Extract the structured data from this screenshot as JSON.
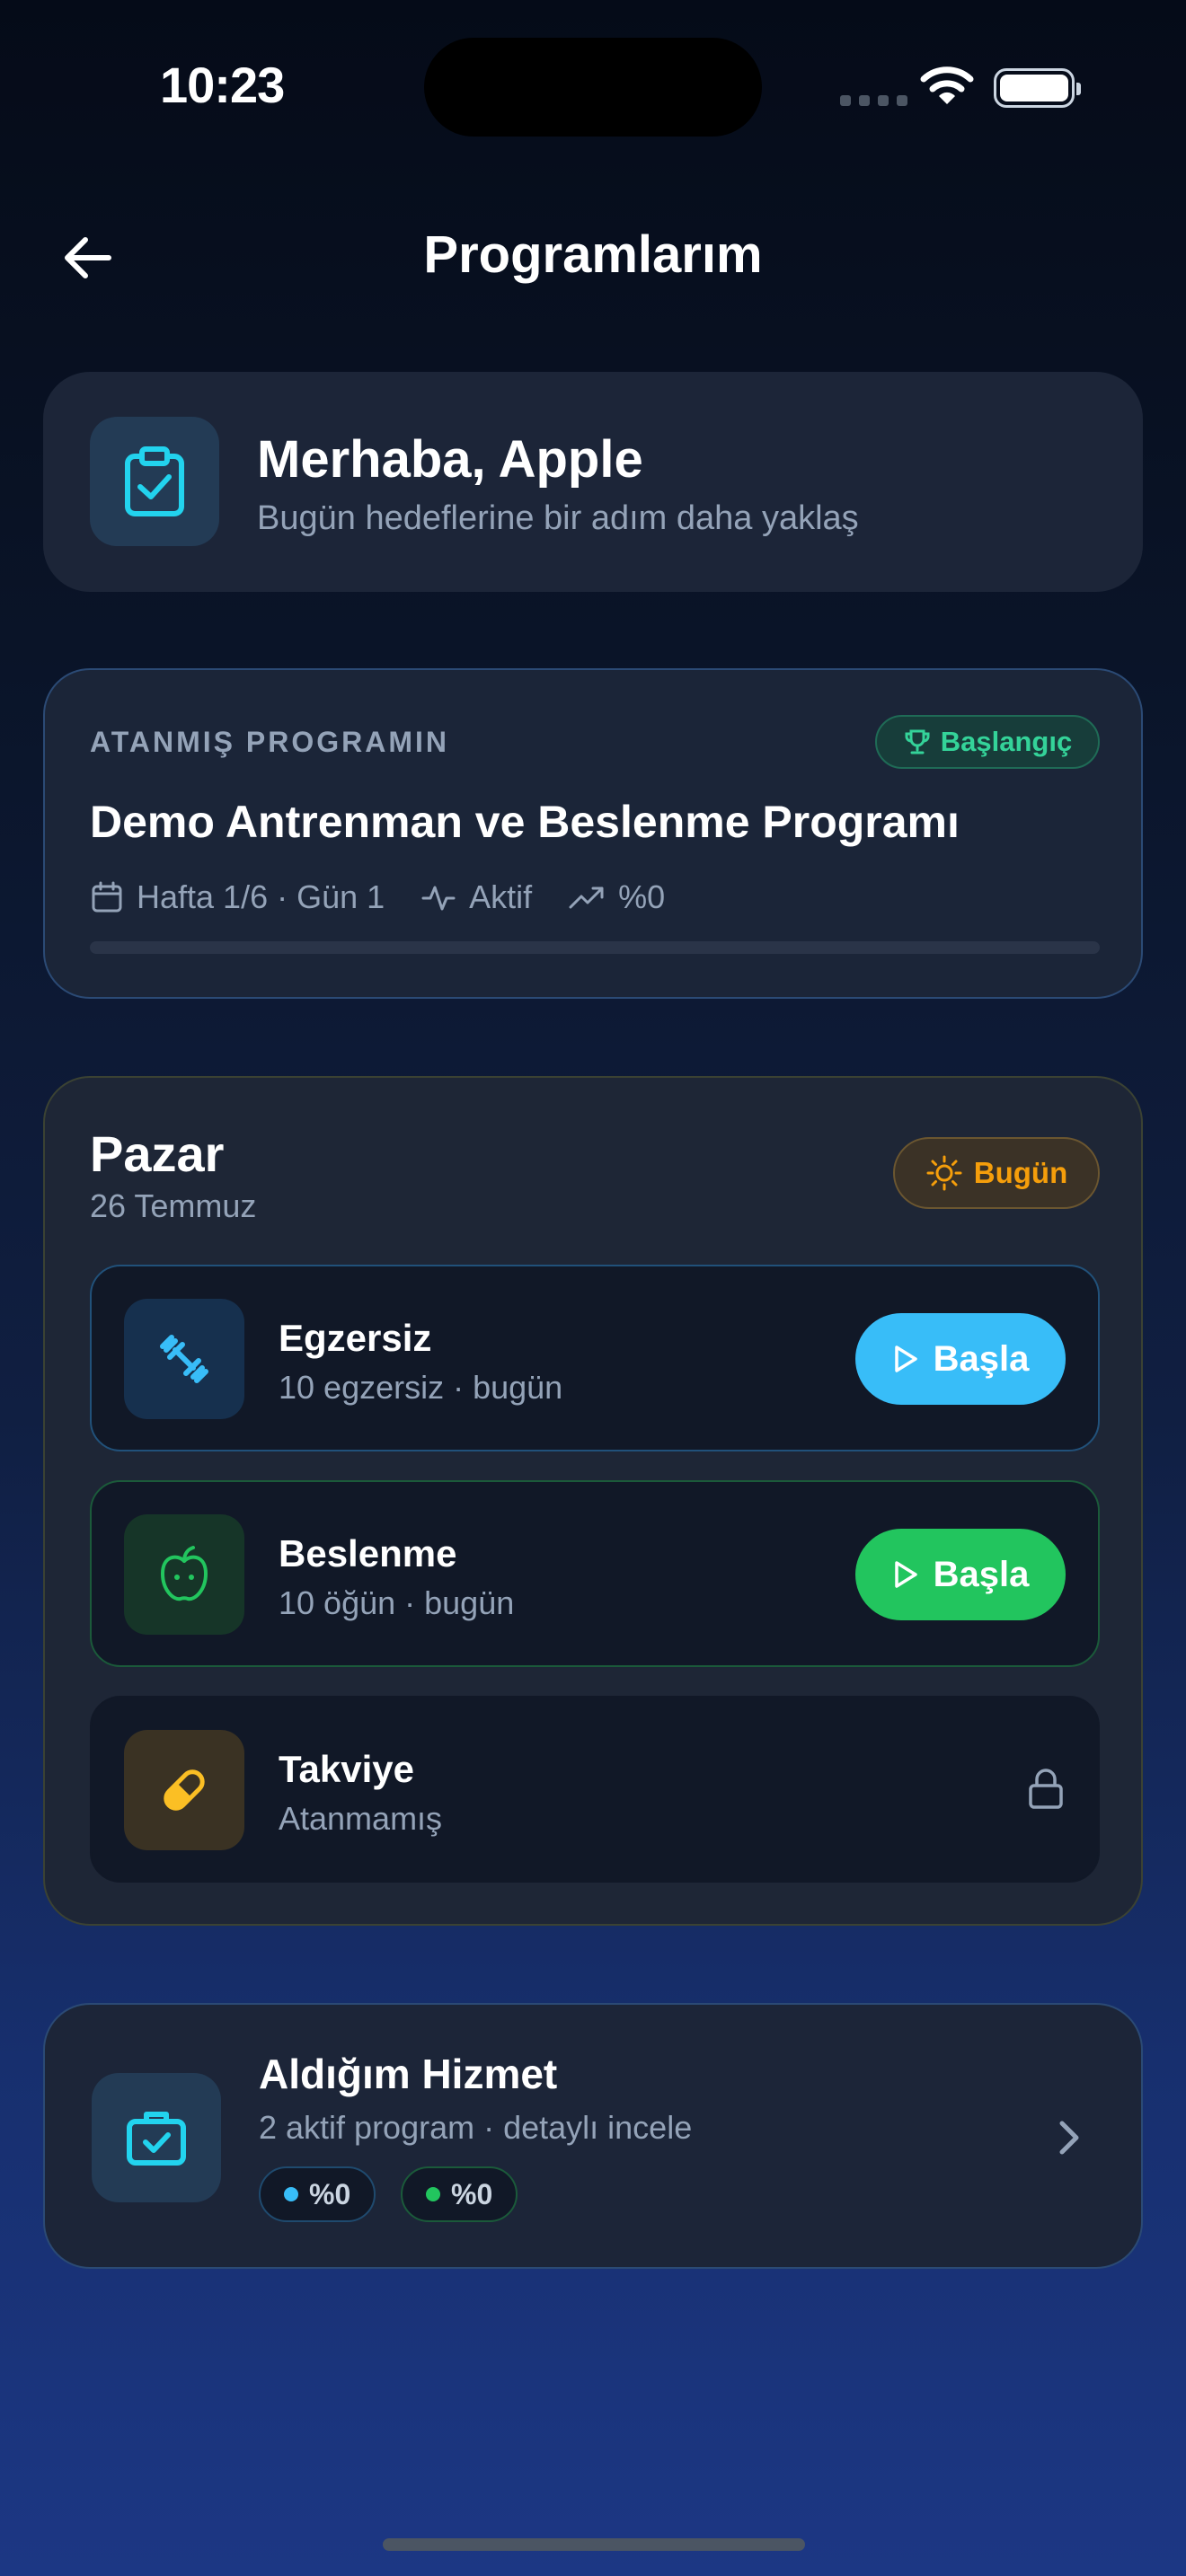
{
  "status_bar": {
    "time": "10:23"
  },
  "header": {
    "title": "Programlarım"
  },
  "welcome": {
    "title": "Merhaba, Apple",
    "subtitle": "Bugün hedeflerine bir adım daha yaklaş",
    "icon": "clipboard-check-icon"
  },
  "program": {
    "label": "ATANMIŞ PROGRAMIN",
    "level": "Başlangıç",
    "title": "Demo Antrenman ve Beslenme Programı",
    "week_day": "Hafta 1/6 · Gün 1",
    "state": "Aktif",
    "progress_text": "%0",
    "progress_fraction": 0
  },
  "day": {
    "name": "Pazar",
    "date": "26 Temmuz",
    "badge": "Bugün",
    "tasks": [
      {
        "title": "Egzersiz",
        "subtitle": "10 egzersiz · bugün",
        "button": "Başla",
        "icon": "dumbbell-icon",
        "accent": "#38bdf8"
      },
      {
        "title": "Beslenme",
        "subtitle": "10 öğün · bugün",
        "button": "Başla",
        "icon": "apple-icon",
        "accent": "#22c55e"
      },
      {
        "title": "Takviye",
        "subtitle": "Atanmamış",
        "icon": "pill-icon",
        "accent": "#fbbf24",
        "locked": true
      }
    ]
  },
  "service": {
    "title": "Aldığım Hizmet",
    "subtitle": "2 aktif program · detaylı incele",
    "pills": [
      {
        "value": "%0",
        "color": "#38bdf8"
      },
      {
        "value": "%0",
        "color": "#22c55e"
      }
    ]
  },
  "colors": {
    "accent_cyan": "#22d3ee",
    "exercise_blue": "#38bdf8",
    "nutrition_green": "#22c55e",
    "today_amber": "#f59e0b",
    "level_green": "#34d399"
  }
}
